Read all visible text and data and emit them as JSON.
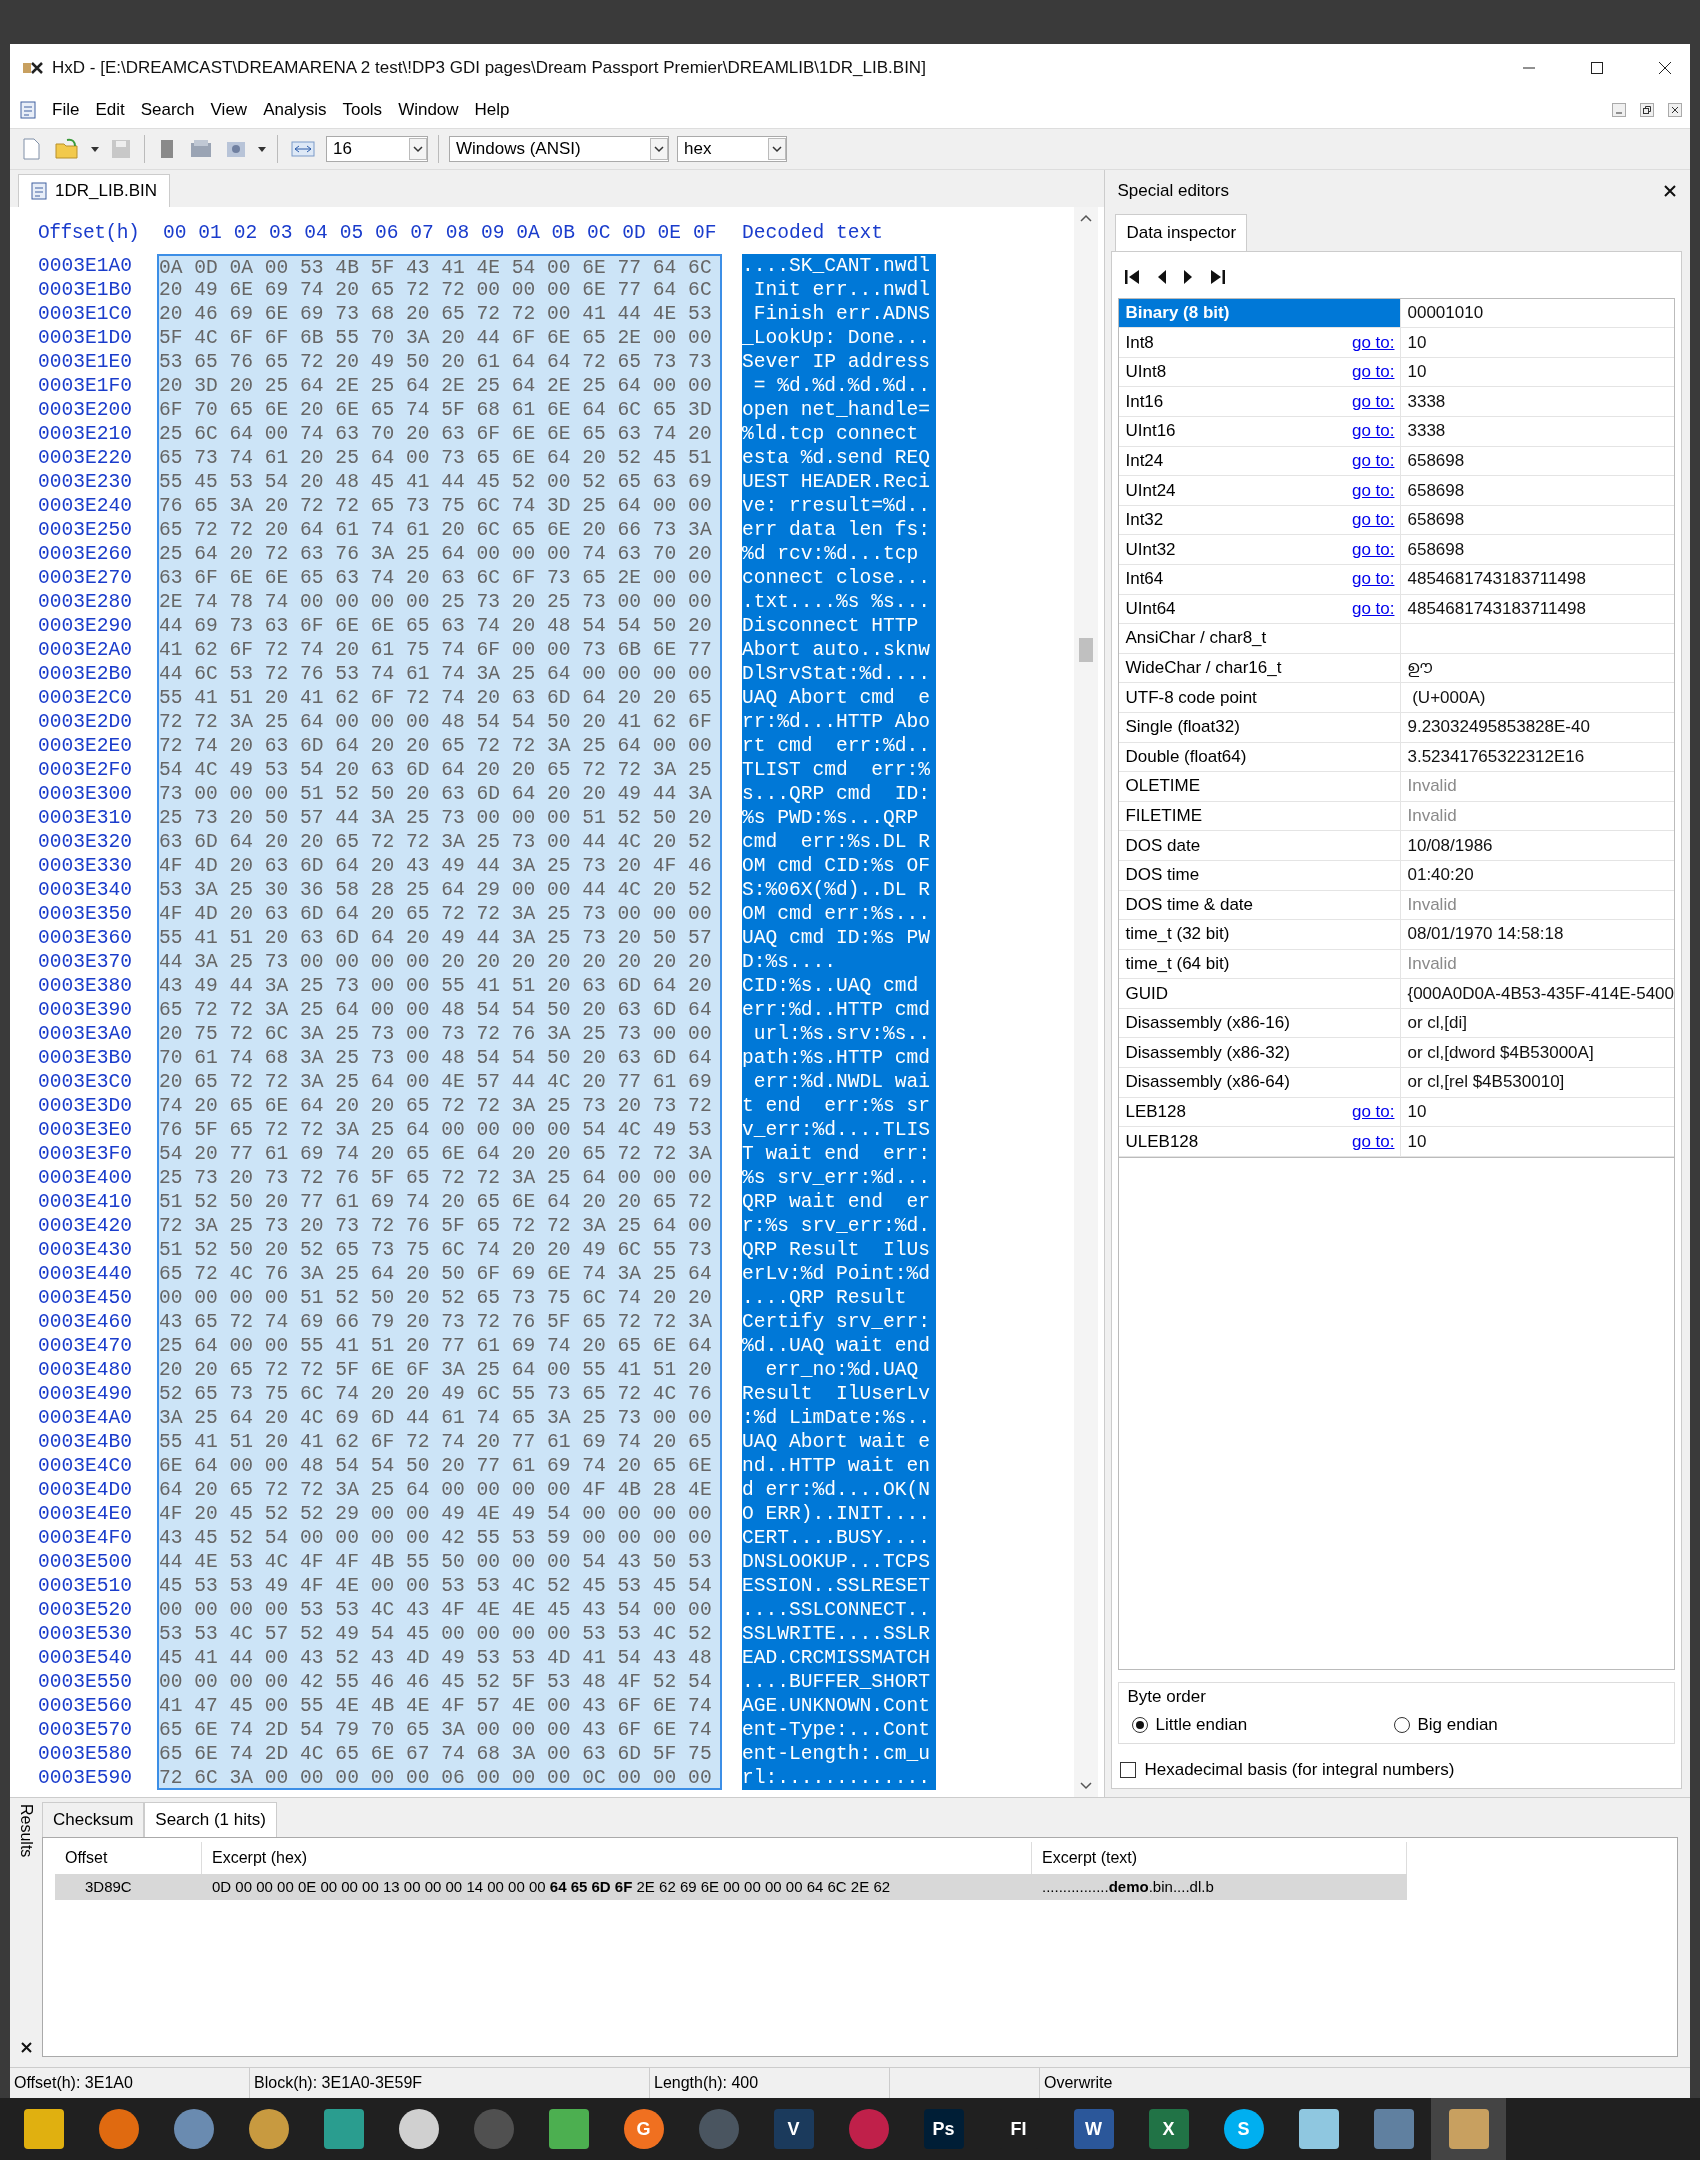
{
  "window": {
    "title": "HxD - [E:\\DREAMCAST\\DREAMARENA 2 test\\!DP3 GDI pages\\Dream Passport Premier\\DREAMLIB\\1DR_LIB.BIN]"
  },
  "menu": [
    "File",
    "Edit",
    "Search",
    "View",
    "Analysis",
    "Tools",
    "Window",
    "Help"
  ],
  "toolbar": {
    "bytes_per_row": "16",
    "encoding": "Windows (ANSI)",
    "display": "hex"
  },
  "document_tab": {
    "label": "1DR_LIB.BIN",
    "selected": true
  },
  "hex_view": {
    "offset_header": "Offset(h)",
    "columns": [
      "00",
      "01",
      "02",
      "03",
      "04",
      "05",
      "06",
      "07",
      "08",
      "09",
      "0A",
      "0B",
      "0C",
      "0D",
      "0E",
      "0F"
    ],
    "decoded_header": "Decoded text",
    "rows": [
      {
        "offset": "0003E1A0",
        "hex": "0A 0D 0A 00 53 4B 5F 43 41 4E 54 00 6E 77 64 6C",
        "text": "....SK_CANT.nwdl",
        "selected": true
      },
      {
        "offset": "0003E1B0",
        "hex": "20 49 6E 69 74 20 65 72 72 00 00 00 6E 77 64 6C",
        "text": " Init err...nwdl",
        "selected": true
      },
      {
        "offset": "0003E1C0",
        "hex": "20 46 69 6E 69 73 68 20 65 72 72 00 41 44 4E 53",
        "text": " Finish err.ADNS",
        "selected": true
      },
      {
        "offset": "0003E1D0",
        "hex": "5F 4C 6F 6F 6B 55 70 3A 20 44 6F 6E 65 2E 00 00",
        "text": "_LookUp: Done...",
        "selected": true
      },
      {
        "offset": "0003E1E0",
        "hex": "53 65 76 65 72 20 49 50 20 61 64 64 72 65 73 73",
        "text": "Sever IP address",
        "selected": true
      },
      {
        "offset": "0003E1F0",
        "hex": "20 3D 20 25 64 2E 25 64 2E 25 64 2E 25 64 00 00",
        "text": " = %d.%d.%d.%d..",
        "selected": true
      },
      {
        "offset": "0003E200",
        "hex": "6F 70 65 6E 20 6E 65 74 5F 68 61 6E 64 6C 65 3D",
        "text": "open net_handle=",
        "selected": true
      },
      {
        "offset": "0003E210",
        "hex": "25 6C 64 00 74 63 70 20 63 6F 6E 6E 65 63 74 20",
        "text": "%ld.tcp connect ",
        "selected": true
      },
      {
        "offset": "0003E220",
        "hex": "65 73 74 61 20 25 64 00 73 65 6E 64 20 52 45 51",
        "text": "esta %d.send REQ",
        "selected": true
      },
      {
        "offset": "0003E230",
        "hex": "55 45 53 54 20 48 45 41 44 45 52 00 52 65 63 69",
        "text": "UEST HEADER.Reci",
        "selected": true
      },
      {
        "offset": "0003E240",
        "hex": "76 65 3A 20 72 72 65 73 75 6C 74 3D 25 64 00 00",
        "text": "ve: rresult=%d..",
        "selected": true
      },
      {
        "offset": "0003E250",
        "hex": "65 72 72 20 64 61 74 61 20 6C 65 6E 20 66 73 3A",
        "text": "err data len fs:",
        "selected": true
      },
      {
        "offset": "0003E260",
        "hex": "25 64 20 72 63 76 3A 25 64 00 00 00 74 63 70 20",
        "text": "%d rcv:%d...tcp ",
        "selected": true
      },
      {
        "offset": "0003E270",
        "hex": "63 6F 6E 6E 65 63 74 20 63 6C 6F 73 65 2E 00 00",
        "text": "connect close...",
        "selected": true
      },
      {
        "offset": "0003E280",
        "hex": "2E 74 78 74 00 00 00 00 25 73 20 25 73 00 00 00",
        "text": ".txt....%s %s...",
        "selected": true
      },
      {
        "offset": "0003E290",
        "hex": "44 69 73 63 6F 6E 6E 65 63 74 20 48 54 54 50 20",
        "text": "Disconnect HTTP ",
        "selected": true
      },
      {
        "offset": "0003E2A0",
        "hex": "41 62 6F 72 74 20 61 75 74 6F 00 00 73 6B 6E 77",
        "text": "Abort auto..sknw",
        "selected": true
      },
      {
        "offset": "0003E2B0",
        "hex": "44 6C 53 72 76 53 74 61 74 3A 25 64 00 00 00 00",
        "text": "DlSrvStat:%d....",
        "selected": true
      },
      {
        "offset": "0003E2C0",
        "hex": "55 41 51 20 41 62 6F 72 74 20 63 6D 64 20 20 65",
        "text": "UAQ Abort cmd  e",
        "selected": true
      },
      {
        "offset": "0003E2D0",
        "hex": "72 72 3A 25 64 00 00 00 48 54 54 50 20 41 62 6F",
        "text": "rr:%d...HTTP Abo",
        "selected": true
      },
      {
        "offset": "0003E2E0",
        "hex": "72 74 20 63 6D 64 20 20 65 72 72 3A 25 64 00 00",
        "text": "rt cmd  err:%d..",
        "selected": true
      },
      {
        "offset": "0003E2F0",
        "hex": "54 4C 49 53 54 20 63 6D 64 20 20 65 72 72 3A 25",
        "text": "TLIST cmd  err:%",
        "selected": true
      },
      {
        "offset": "0003E300",
        "hex": "73 00 00 00 51 52 50 20 63 6D 64 20 20 49 44 3A",
        "text": "s...QRP cmd  ID:",
        "selected": true
      },
      {
        "offset": "0003E310",
        "hex": "25 73 20 50 57 44 3A 25 73 00 00 00 51 52 50 20",
        "text": "%s PWD:%s...QRP ",
        "selected": true
      },
      {
        "offset": "0003E320",
        "hex": "63 6D 64 20 20 65 72 72 3A 25 73 00 44 4C 20 52",
        "text": "cmd  err:%s.DL R",
        "selected": true
      },
      {
        "offset": "0003E330",
        "hex": "4F 4D 20 63 6D 64 20 43 49 44 3A 25 73 20 4F 46",
        "text": "OM cmd CID:%s OF",
        "selected": true
      },
      {
        "offset": "0003E340",
        "hex": "53 3A 25 30 36 58 28 25 64 29 00 00 44 4C 20 52",
        "text": "S:%06X(%d)..DL R",
        "selected": true
      },
      {
        "offset": "0003E350",
        "hex": "4F 4D 20 63 6D 64 20 65 72 72 3A 25 73 00 00 00",
        "text": "OM cmd err:%s...",
        "selected": true
      },
      {
        "offset": "0003E360",
        "hex": "55 41 51 20 63 6D 64 20 49 44 3A 25 73 20 50 57",
        "text": "UAQ cmd ID:%s PW",
        "selected": true
      },
      {
        "offset": "0003E370",
        "hex": "44 3A 25 73 00 00 00 00 20 20 20 20 20 20 20 20",
        "text": "D:%s....        ",
        "selected": true
      },
      {
        "offset": "0003E380",
        "hex": "43 49 44 3A 25 73 00 00 55 41 51 20 63 6D 64 20",
        "text": "CID:%s..UAQ cmd ",
        "selected": true
      },
      {
        "offset": "0003E390",
        "hex": "65 72 72 3A 25 64 00 00 48 54 54 50 20 63 6D 64",
        "text": "err:%d..HTTP cmd",
        "selected": true
      },
      {
        "offset": "0003E3A0",
        "hex": "20 75 72 6C 3A 25 73 00 73 72 76 3A 25 73 00 00",
        "text": " url:%s.srv:%s..",
        "selected": true
      },
      {
        "offset": "0003E3B0",
        "hex": "70 61 74 68 3A 25 73 00 48 54 54 50 20 63 6D 64",
        "text": "path:%s.HTTP cmd",
        "selected": true
      },
      {
        "offset": "0003E3C0",
        "hex": "20 65 72 72 3A 25 64 00 4E 57 44 4C 20 77 61 69",
        "text": " err:%d.NWDL wai",
        "selected": true
      },
      {
        "offset": "0003E3D0",
        "hex": "74 20 65 6E 64 20 20 65 72 72 3A 25 73 20 73 72",
        "text": "t end  err:%s sr",
        "selected": true
      },
      {
        "offset": "0003E3E0",
        "hex": "76 5F 65 72 72 3A 25 64 00 00 00 00 54 4C 49 53",
        "text": "v_err:%d....TLIS",
        "selected": true
      },
      {
        "offset": "0003E3F0",
        "hex": "54 20 77 61 69 74 20 65 6E 64 20 20 65 72 72 3A",
        "text": "T wait end  err:",
        "selected": true
      },
      {
        "offset": "0003E400",
        "hex": "25 73 20 73 72 76 5F 65 72 72 3A 25 64 00 00 00",
        "text": "%s srv_err:%d...",
        "selected": true
      },
      {
        "offset": "0003E410",
        "hex": "51 52 50 20 77 61 69 74 20 65 6E 64 20 20 65 72",
        "text": "QRP wait end  er",
        "selected": true
      },
      {
        "offset": "0003E420",
        "hex": "72 3A 25 73 20 73 72 76 5F 65 72 72 3A 25 64 00",
        "text": "r:%s srv_err:%d.",
        "selected": true
      },
      {
        "offset": "0003E430",
        "hex": "51 52 50 20 52 65 73 75 6C 74 20 20 49 6C 55 73",
        "text": "QRP Result  IlUs",
        "selected": true
      },
      {
        "offset": "0003E440",
        "hex": "65 72 4C 76 3A 25 64 20 50 6F 69 6E 74 3A 25 64",
        "text": "erLv:%d Point:%d",
        "selected": true
      },
      {
        "offset": "0003E450",
        "hex": "00 00 00 00 51 52 50 20 52 65 73 75 6C 74 20 20",
        "text": "....QRP Result  ",
        "selected": true
      },
      {
        "offset": "0003E460",
        "hex": "43 65 72 74 69 66 79 20 73 72 76 5F 65 72 72 3A",
        "text": "Certify srv_err:",
        "selected": true
      },
      {
        "offset": "0003E470",
        "hex": "25 64 00 00 55 41 51 20 77 61 69 74 20 65 6E 64",
        "text": "%d..UAQ wait end",
        "selected": true
      },
      {
        "offset": "0003E480",
        "hex": "20 20 65 72 72 5F 6E 6F 3A 25 64 00 55 41 51 20",
        "text": "  err_no:%d.UAQ ",
        "selected": true
      },
      {
        "offset": "0003E490",
        "hex": "52 65 73 75 6C 74 20 20 49 6C 55 73 65 72 4C 76",
        "text": "Result  IlUserLv",
        "selected": true
      },
      {
        "offset": "0003E4A0",
        "hex": "3A 25 64 20 4C 69 6D 44 61 74 65 3A 25 73 00 00",
        "text": ":%d LimDate:%s..",
        "selected": true
      },
      {
        "offset": "0003E4B0",
        "hex": "55 41 51 20 41 62 6F 72 74 20 77 61 69 74 20 65",
        "text": "UAQ Abort wait e",
        "selected": true
      },
      {
        "offset": "0003E4C0",
        "hex": "6E 64 00 00 48 54 54 50 20 77 61 69 74 20 65 6E",
        "text": "nd..HTTP wait en",
        "selected": true
      },
      {
        "offset": "0003E4D0",
        "hex": "64 20 65 72 72 3A 25 64 00 00 00 00 4F 4B 28 4E",
        "text": "d err:%d....OK(N",
        "selected": true
      },
      {
        "offset": "0003E4E0",
        "hex": "4F 20 45 52 52 29 00 00 49 4E 49 54 00 00 00 00",
        "text": "O ERR)..INIT....",
        "selected": true
      },
      {
        "offset": "0003E4F0",
        "hex": "43 45 52 54 00 00 00 00 42 55 53 59 00 00 00 00",
        "text": "CERT....BUSY....",
        "selected": true
      },
      {
        "offset": "0003E500",
        "hex": "44 4E 53 4C 4F 4F 4B 55 50 00 00 00 54 43 50 53",
        "text": "DNSLOOKUP...TCPS",
        "selected": true
      },
      {
        "offset": "0003E510",
        "hex": "45 53 53 49 4F 4E 00 00 53 53 4C 52 45 53 45 54",
        "text": "ESSION..SSLRESET",
        "selected": true
      },
      {
        "offset": "0003E520",
        "hex": "00 00 00 00 53 53 4C 43 4F 4E 4E 45 43 54 00 00",
        "text": "....SSLCONNECT..",
        "selected": true
      },
      {
        "offset": "0003E530",
        "hex": "53 53 4C 57 52 49 54 45 00 00 00 00 53 53 4C 52",
        "text": "SSLWRITE....SSLR",
        "selected": true
      },
      {
        "offset": "0003E540",
        "hex": "45 41 44 00 43 52 43 4D 49 53 53 4D 41 54 43 48",
        "text": "EAD.CRCMISSMATCH",
        "selected": true
      },
      {
        "offset": "0003E550",
        "hex": "00 00 00 00 42 55 46 46 45 52 5F 53 48 4F 52 54",
        "text": "....BUFFER_SHORT",
        "selected": true
      },
      {
        "offset": "0003E560",
        "hex": "41 47 45 00 55 4E 4B 4E 4F 57 4E 00 43 6F 6E 74",
        "text": "AGE.UNKNOWN.Cont",
        "selected": true
      },
      {
        "offset": "0003E570",
        "hex": "65 6E 74 2D 54 79 70 65 3A 00 00 00 43 6F 6E 74",
        "text": "ent-Type:...Cont",
        "selected": true
      },
      {
        "offset": "0003E580",
        "hex": "65 6E 74 2D 4C 65 6E 67 74 68 3A 00 63 6D 5F 75",
        "text": "ent-Length:.cm_u",
        "selected": true
      },
      {
        "offset": "0003E590",
        "hex": "72 6C 3A 00 00 00 00 00 06 00 00 00 0C 00 00 00",
        "text": "rl:.............",
        "selected": true
      }
    ]
  },
  "special_editors": {
    "title": "Special editors",
    "tab": {
      "label": "Data inspector",
      "selected": true
    },
    "inspector_rows": [
      {
        "label": "Binary (8 bit)",
        "value": "00001010",
        "selected": true,
        "dimmed": false
      },
      {
        "label": "Int8",
        "link": "go to:",
        "value": "10",
        "selected": false,
        "dimmed": false
      },
      {
        "label": "UInt8",
        "link": "go to:",
        "value": "10",
        "selected": false,
        "dimmed": false
      },
      {
        "label": "Int16",
        "link": "go to:",
        "value": "3338",
        "selected": false,
        "dimmed": false
      },
      {
        "label": "UInt16",
        "link": "go to:",
        "value": "3338",
        "selected": false,
        "dimmed": false
      },
      {
        "label": "Int24",
        "link": "go to:",
        "value": "658698",
        "selected": false,
        "dimmed": false
      },
      {
        "label": "UInt24",
        "link": "go to:",
        "value": "658698",
        "selected": false,
        "dimmed": false
      },
      {
        "label": "Int32",
        "link": "go to:",
        "value": "658698",
        "selected": false,
        "dimmed": false
      },
      {
        "label": "UInt32",
        "link": "go to:",
        "value": "658698",
        "selected": false,
        "dimmed": false
      },
      {
        "label": "Int64",
        "link": "go to:",
        "value": "4854681743183711498",
        "selected": false,
        "dimmed": false
      },
      {
        "label": "UInt64",
        "link": "go to:",
        "value": "4854681743183711498",
        "selected": false,
        "dimmed": false
      },
      {
        "label": "AnsiChar / char8_t",
        "selected": false
      },
      {
        "label": "WideChar / char16_t",
        "value": "ഊ",
        "selected": false,
        "dimmed": false
      },
      {
        "label": "UTF-8 code point",
        "value": " (U+000A)",
        "selected": false,
        "dimmed": false
      },
      {
        "label": "Single (float32)",
        "value": "9.23032495853828E-40",
        "selected": false,
        "dimmed": false
      },
      {
        "label": "Double (float64)",
        "value": "3.52341765322312E16",
        "selected": false,
        "dimmed": false
      },
      {
        "label": "OLETIME",
        "value": "Invalid",
        "selected": false,
        "dimmed": true
      },
      {
        "label": "FILETIME",
        "value": "Invalid",
        "selected": false,
        "dimmed": true
      },
      {
        "label": "DOS date",
        "value": "10/08/1986",
        "selected": false,
        "dimmed": false
      },
      {
        "label": "DOS time",
        "value": "01:40:20",
        "selected": false,
        "dimmed": false
      },
      {
        "label": "DOS time & date",
        "value": "Invalid",
        "selected": false,
        "dimmed": true
      },
      {
        "label": "time_t (32 bit)",
        "value": "08/01/1970 14:58:18",
        "selected": false,
        "dimmed": false
      },
      {
        "label": "time_t (64 bit)",
        "value": "Invalid",
        "selected": false,
        "dimmed": true
      },
      {
        "label": "GUID",
        "value": "{000A0D0A-4B53-435F-414E-5400",
        "selected": false,
        "dimmed": false
      },
      {
        "label": "Disassembly (x86-16)",
        "value": "or cl,[di]",
        "selected": false,
        "dimmed": false
      },
      {
        "label": "Disassembly (x86-32)",
        "value": "or cl,[dword $4B53000A]",
        "selected": false,
        "dimmed": false
      },
      {
        "label": "Disassembly (x86-64)",
        "value": "or cl,[rel $4B530010]",
        "selected": false,
        "dimmed": false
      },
      {
        "label": "LEB128",
        "link": "go to:",
        "value": "10",
        "selected": false,
        "dimmed": false
      },
      {
        "label": "ULEB128",
        "link": "go to:",
        "value": "10",
        "selected": false,
        "dimmed": false
      }
    ],
    "byte_order": {
      "title": "Byte order",
      "options": [
        {
          "label": "Little endian",
          "selected": true
        },
        {
          "label": "Big endian",
          "selected": false
        }
      ]
    },
    "hex_basis": {
      "label": "Hexadecimal basis (for integral numbers)",
      "checked": false
    }
  },
  "results": {
    "title": "Results",
    "tabs": [
      {
        "label": "Checksum",
        "selected": false
      },
      {
        "label": "Search (1 hits)",
        "selected": true
      }
    ],
    "columns": [
      "Offset",
      "Excerpt (hex)",
      "Excerpt (text)"
    ],
    "rows": [
      {
        "offset": "3D89C",
        "hex": "0D 00 00 00 0E 00 00 00 13 00 00 00 14 00 00 00 **64 65 6D 6F** 2E 62 69 6E 00 00 00 00 64 6C 2E 62",
        "text": "................**demo**.bin....dl.b",
        "selected": true
      }
    ]
  },
  "status_bar": [
    "Offset(h): 3E1A0",
    "Block(h): 3E1A0-3E59F",
    "Length(h): 400",
    "Overwrite"
  ],
  "taskbar": [
    {
      "kind": "tile",
      "color": "#e0b010",
      "selected": false
    },
    {
      "kind": "disc",
      "color": "#e06a10",
      "selected": false
    },
    {
      "kind": "disc",
      "color": "#6a8bb0",
      "selected": false
    },
    {
      "kind": "disc",
      "color": "#c89a40",
      "selected": false
    },
    {
      "kind": "tile",
      "color": "#2a9d8f",
      "selected": false
    },
    {
      "kind": "disc",
      "color": "#d0d0d0",
      "selected": false
    },
    {
      "kind": "disc",
      "color": "#505050",
      "selected": false
    },
    {
      "kind": "tile",
      "color": "#4caf50",
      "selected": false
    },
    {
      "kind": "disc",
      "color": "#f07020",
      "glyph": "G",
      "selected": false
    },
    {
      "kind": "disc",
      "color": "#4a5560",
      "selected": false
    },
    {
      "kind": "tile",
      "color": "#1b3a5c",
      "glyph": "V",
      "selected": false
    },
    {
      "kind": "disc",
      "color": "#c0204a",
      "selected": false
    },
    {
      "kind": "tile",
      "color": "#001e36",
      "glyph": "Ps",
      "selected": false
    },
    {
      "kind": "tile",
      "color": "#202020",
      "glyph": "FI",
      "selected": false
    },
    {
      "kind": "tile",
      "color": "#2b579a",
      "glyph": "W",
      "selected": false
    },
    {
      "kind": "tile",
      "color": "#217346",
      "glyph": "X",
      "selected": false
    },
    {
      "kind": "disc",
      "color": "#00aff0",
      "glyph": "S",
      "selected": false
    },
    {
      "kind": "tile",
      "color": "#8fc7e0",
      "selected": false
    },
    {
      "kind": "tile",
      "color": "#6080a0",
      "selected": false
    },
    {
      "kind": "tile",
      "color": "#c8a060",
      "selected": true
    }
  ]
}
